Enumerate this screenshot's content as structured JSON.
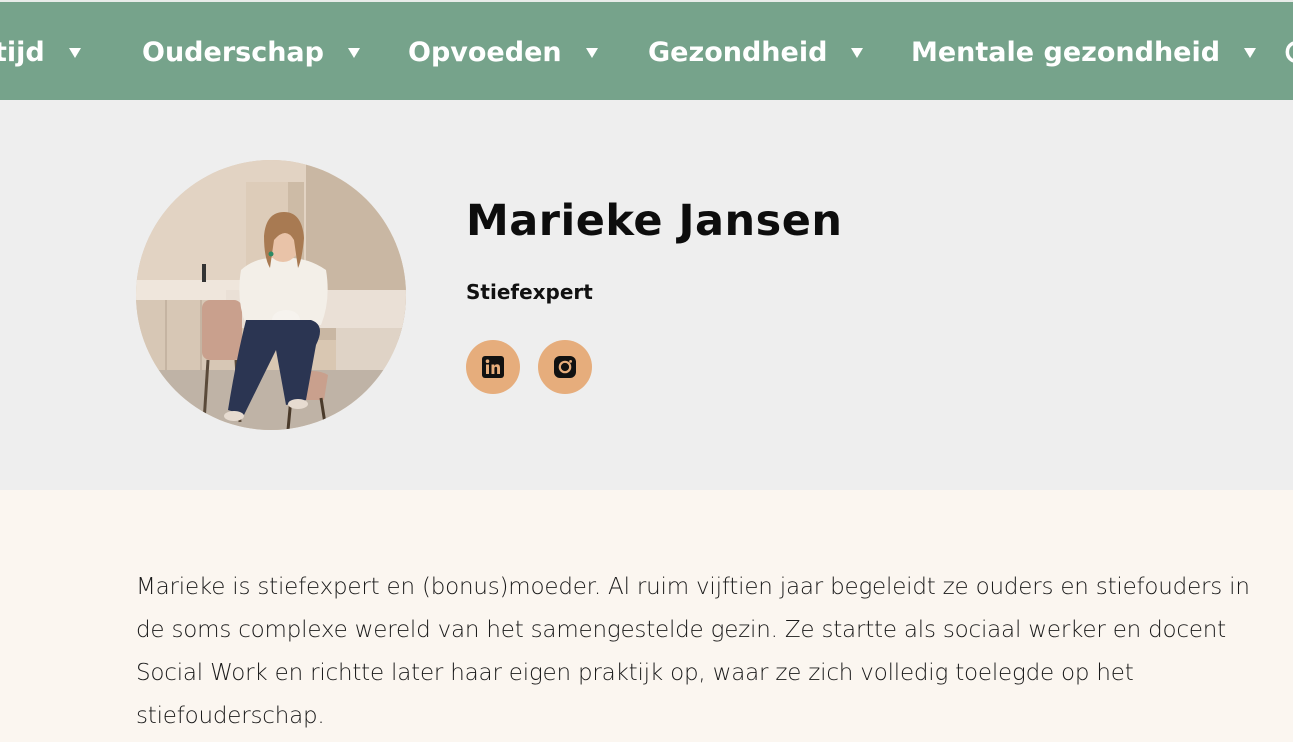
{
  "nav": {
    "items": [
      {
        "label": "tijd"
      },
      {
        "label": "Ouderschap"
      },
      {
        "label": "Opvoeden"
      },
      {
        "label": "Gezondheid"
      },
      {
        "label": "Mentale gezondheid"
      }
    ],
    "background": "#76a38b"
  },
  "profile": {
    "name": "Marieke Jansen",
    "role": "Stiefexpert",
    "avatar_icon": "profile-photo",
    "social": [
      {
        "icon": "linkedin-icon"
      },
      {
        "icon": "instagram-icon"
      }
    ],
    "accent": "#e6ad7c"
  },
  "bio": {
    "text": "Marieke is stiefexpert en (bonus)moeder. Al ruim vijftien jaar begeleidt ze ouders en stiefouders in de soms complexe wereld van het samengestelde gezin. Ze startte als sociaal werker en docent Social Work en richtte later haar eigen praktijk op, waar ze zich volledig toelegde op het stiefouderschap."
  }
}
